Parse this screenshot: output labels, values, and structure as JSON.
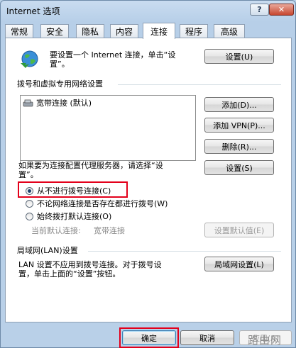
{
  "window": {
    "title": "Internet 选项",
    "help_label": "?",
    "close_label": "✕"
  },
  "tabs": [
    "常规",
    "安全",
    "隐私",
    "内容",
    "连接",
    "程序",
    "高级"
  ],
  "active_tab": "连接",
  "setup": {
    "line1": "要设置一个 Internet 连接，单击“设",
    "line2": "置”。",
    "button": "设置(U)"
  },
  "dialup": {
    "group_title": "拨号和虚拟专用网络设置",
    "list_item": "宽带连接 (默认)",
    "add_button": "添加(D)...",
    "add_vpn_button": "添加 VPN(P)...",
    "remove_button": "删除(R)...",
    "proxy_line1": "如果要为连接配置代理服务器，请选择“设",
    "proxy_line2": "置”。",
    "settings_button": "设置(S)",
    "options": [
      "从不进行拨号连接(C)",
      "不论网络连接是否存在都进行拨号(W)",
      "始终拨打默认连接(O)"
    ],
    "selected_option": 0,
    "current_default_label": "当前默认连接:",
    "current_default_value": "宽带连接",
    "set_default_button": "设置默认值(E)"
  },
  "lan": {
    "group_title": "局域网(LAN)设置",
    "line1": "LAN 设置不应用到拨号连接。对于拨号设",
    "line2": "置，单击上面的“设置”按钮。",
    "button": "局域网设置(L)"
  },
  "footer": {
    "ok": "确定",
    "cancel": "取消",
    "apply": "应用(A)"
  },
  "watermark": "路由网"
}
